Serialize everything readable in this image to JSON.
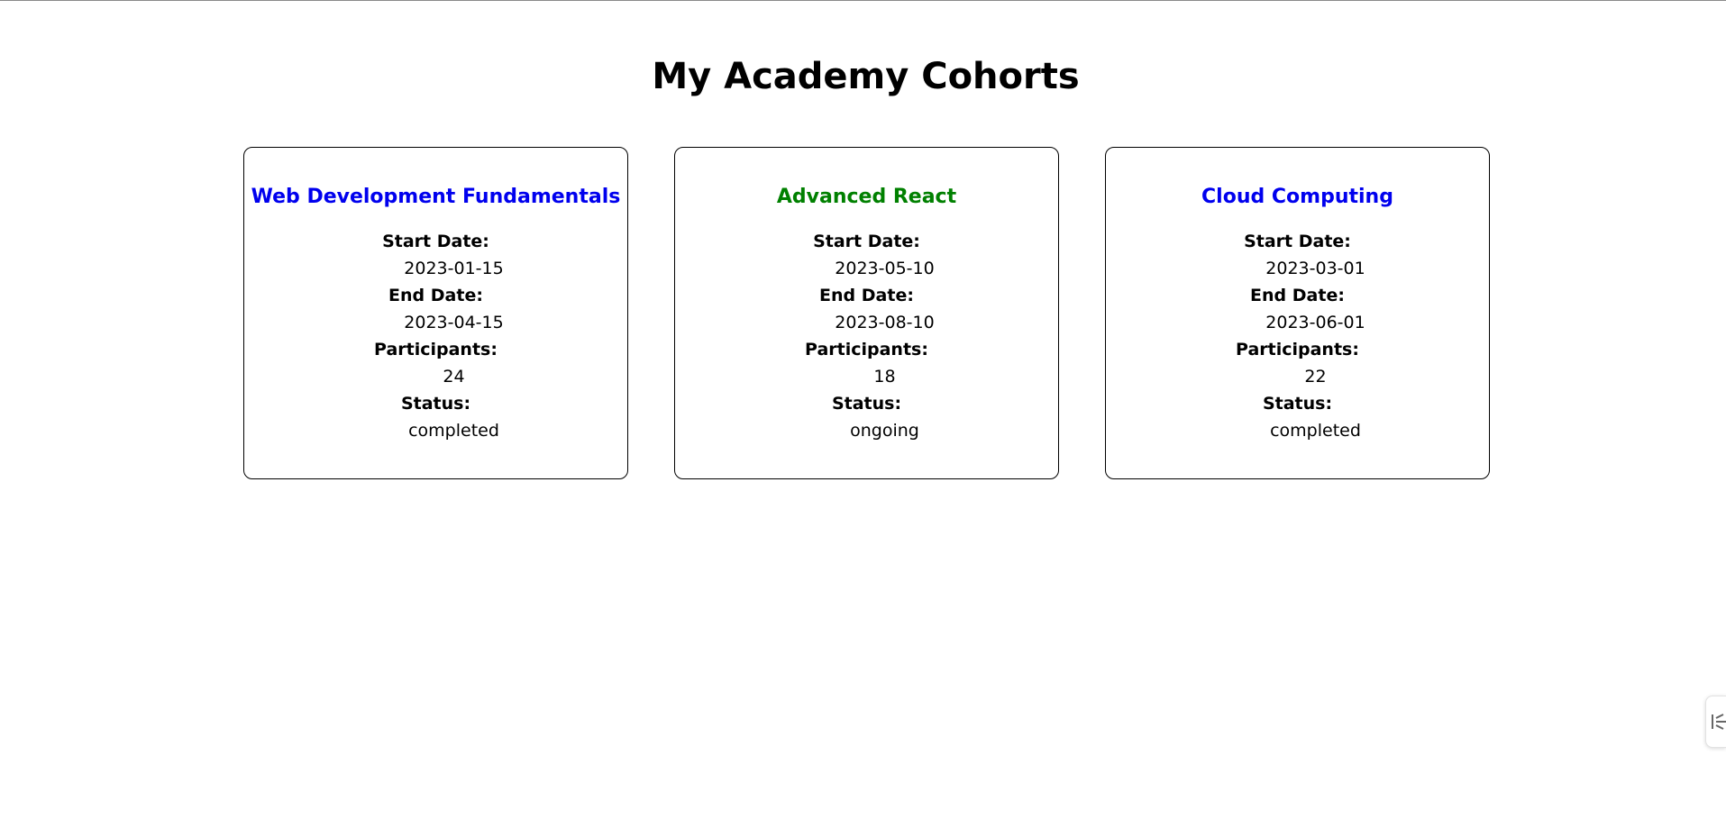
{
  "page": {
    "title": "My Academy Cohorts"
  },
  "labels": {
    "start_date": "Start Date:",
    "end_date": "End Date:",
    "participants": "Participants:",
    "status": "Status:"
  },
  "cohorts": [
    {
      "name": "Web Development Fundamentals",
      "title_color": "#0000ee",
      "start_date": "2023-01-15",
      "end_date": "2023-04-15",
      "participants": "24",
      "status": "completed"
    },
    {
      "name": "Advanced React",
      "title_color": "#008000",
      "start_date": "2023-05-10",
      "end_date": "2023-08-10",
      "participants": "18",
      "status": "ongoing"
    },
    {
      "name": "Cloud Computing",
      "title_color": "#0000ee",
      "start_date": "2023-03-01",
      "end_date": "2023-06-01",
      "participants": "22",
      "status": "completed"
    }
  ],
  "side_handle": {
    "icon": "collapse-arrows-icon"
  }
}
